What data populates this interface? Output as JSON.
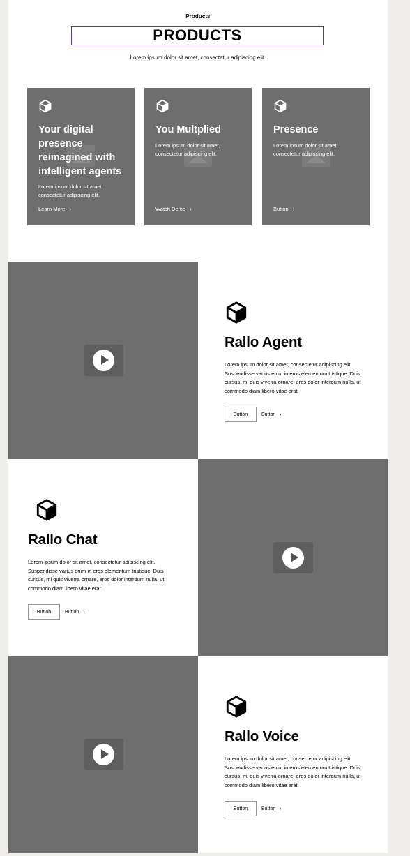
{
  "header": {
    "eyebrow": "Products",
    "title": "PRODUCTS",
    "subtitle": "Lorem ipsum dolor sit amet, consectetur adipiscing elit."
  },
  "cards": [
    {
      "icon": "cube-icon",
      "title": "Your digital presence reimagined with intelligent agents",
      "text": "Lorem ipsum dolor sit amet, consectetur adipiscing elit.",
      "cta": "Learn More"
    },
    {
      "icon": "cube-icon",
      "title": "You Multplied",
      "text": "Lorem ipsum dolor sit amet, consectetur adipiscing elit.",
      "cta": "Watch Demo"
    },
    {
      "icon": "cube-icon",
      "title": "Presence",
      "text": "Lorem ipsum dolor sit amet, consectetur adipiscing elit.",
      "cta": "Button"
    }
  ],
  "features": [
    {
      "icon": "cube-icon",
      "title": "Rallo Agent",
      "text": "Lorem ipsum dolor sit amet, consectetur adipiscing elit. Suspendisse varius enim in eros elementum tristique. Duis cursus, mi quis viverra ornare, eros dolor interdum nulla, ut commodo diam libero vitae erat.",
      "primary_button": "Button",
      "link_button": "Button"
    },
    {
      "icon": "cube-icon",
      "title": "Rallo Chat",
      "text": "Lorem ipsum dolor sit amet, consectetur adipiscing elit. Suspendisse varius enim in eros elementum tristique. Duis cursus, mi quis viverra ornare, eros dolor interdum nulla, ut commodo diam libero vitae erat.",
      "primary_button": "Button",
      "link_button": "Button"
    },
    {
      "icon": "cube-icon",
      "title": "Rallo Voice",
      "text": "Lorem ipsum dolor sit amet, consectetur adipiscing elit. Suspendisse varius enim in eros elementum tristique. Duis cursus, mi quis viverra ornare, eros dolor interdum nulla, ut commodo diam libero vitae erat.",
      "primary_button": "Button",
      "link_button": "Button"
    }
  ],
  "colors": {
    "placeholder_gray": "#6e6e6e",
    "title_border": "#5a3f8f",
    "page_bg": "#efeeeb"
  }
}
